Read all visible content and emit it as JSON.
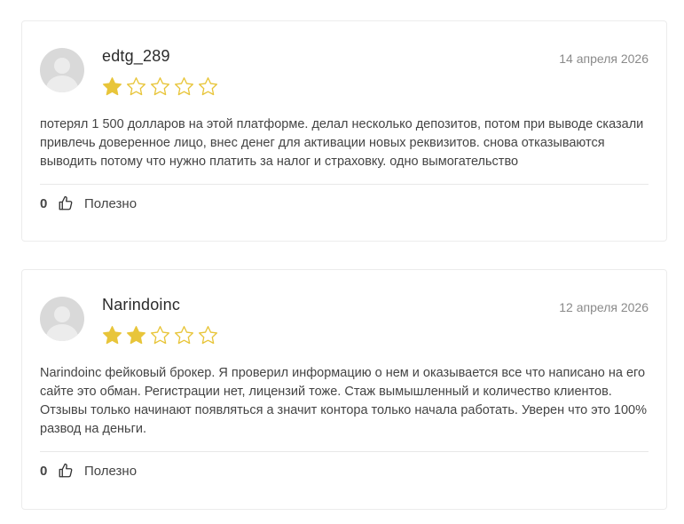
{
  "colors": {
    "star_filled": "#e8c53a",
    "star_empty_stroke": "#e8c53a"
  },
  "reviews": [
    {
      "author": "edtg_289",
      "date": "14 апреля 2026",
      "rating": 1,
      "max_rating": 5,
      "text": "потерял 1 500 долларов на этой платформе. делал несколько депозитов, потом при выводе сказали привлечь доверенное лицо, внес денег для активации новых реквизитов. снова отказываются выводить потому что нужно платить за налог и страховку. одно вымогательство",
      "likes": "0",
      "helpful_label": "Полезно",
      "avatar_icon": "user-avatar-placeholder",
      "like_icon": "thumbs-up-icon"
    },
    {
      "author": "Narindoinc",
      "date": "12 апреля 2026",
      "rating": 2,
      "max_rating": 5,
      "text": "Narindoinc фейковый брокер. Я проверил информацию о нем и оказывается все что написано на его сайте это обман. Регистрации нет, лицензий тоже. Стаж вымышленный и количество клиентов. Отзывы только начинают появляться а значит контора только начала работать. Уверен что это 100% развод на деньги.",
      "likes": "0",
      "helpful_label": "Полезно",
      "avatar_icon": "user-avatar-placeholder",
      "like_icon": "thumbs-up-icon"
    }
  ]
}
